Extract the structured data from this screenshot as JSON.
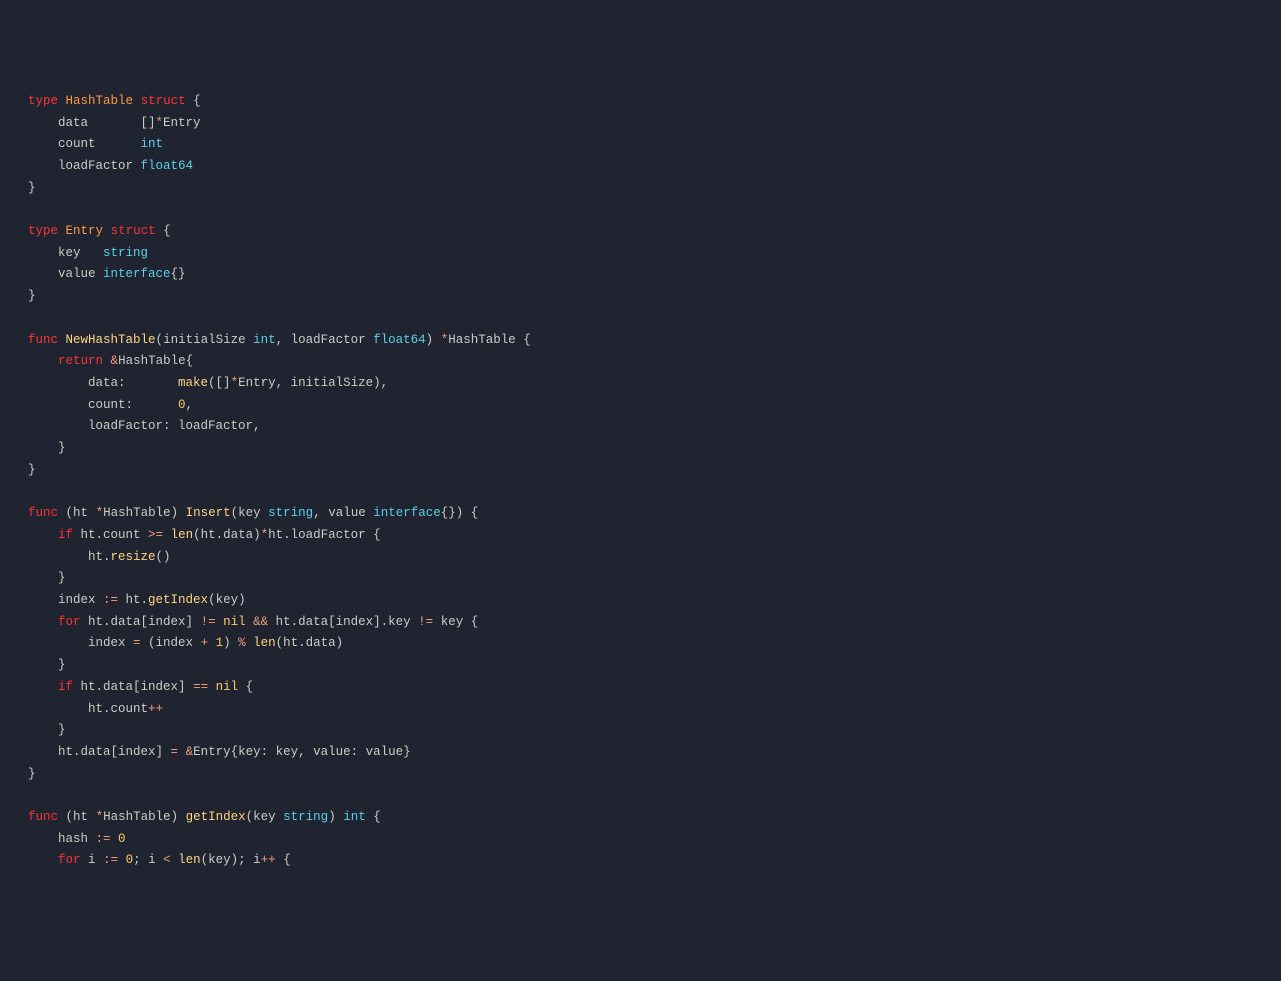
{
  "tokens": [
    [
      [
        "kw-decl",
        "type"
      ],
      [
        "",
        " "
      ],
      [
        "type-name",
        "HashTable"
      ],
      [
        "",
        " "
      ],
      [
        "kw-decl",
        "struct"
      ],
      [
        "",
        " {"
      ]
    ],
    [
      [
        "",
        "    data       []"
      ],
      [
        "op",
        "*"
      ],
      [
        "",
        "Entry"
      ]
    ],
    [
      [
        "",
        "    count      "
      ],
      [
        "builtin-type",
        "int"
      ]
    ],
    [
      [
        "",
        "    loadFactor "
      ],
      [
        "builtin-type",
        "float64"
      ]
    ],
    [
      [
        "",
        "}"
      ]
    ],
    [
      [
        "",
        ""
      ]
    ],
    [
      [
        "kw-decl",
        "type"
      ],
      [
        "",
        " "
      ],
      [
        "type-name",
        "Entry"
      ],
      [
        "",
        " "
      ],
      [
        "kw-decl",
        "struct"
      ],
      [
        "",
        " {"
      ]
    ],
    [
      [
        "",
        "    key   "
      ],
      [
        "str-type",
        "string"
      ]
    ],
    [
      [
        "",
        "    value "
      ],
      [
        "iface",
        "interface"
      ],
      [
        "",
        "{}"
      ]
    ],
    [
      [
        "",
        "}"
      ]
    ],
    [
      [
        "",
        ""
      ]
    ],
    [
      [
        "kw-decl",
        "func"
      ],
      [
        "",
        " "
      ],
      [
        "func-name",
        "NewHashTable"
      ],
      [
        "",
        "("
      ],
      [
        "param",
        "initialSize"
      ],
      [
        "",
        " "
      ],
      [
        "builtin-type",
        "int"
      ],
      [
        "",
        ", "
      ],
      [
        "param",
        "loadFactor"
      ],
      [
        "",
        " "
      ],
      [
        "builtin-type",
        "float64"
      ],
      [
        "",
        ") "
      ],
      [
        "op",
        "*"
      ],
      [
        "",
        "HashTable {"
      ]
    ],
    [
      [
        "",
        "    "
      ],
      [
        "kw-ctrl",
        "return"
      ],
      [
        "",
        " "
      ],
      [
        "op",
        "&"
      ],
      [
        "",
        "HashTable{"
      ]
    ],
    [
      [
        "",
        "        data:       "
      ],
      [
        "builtin-func",
        "make"
      ],
      [
        "",
        "([]"
      ],
      [
        "op",
        "*"
      ],
      [
        "",
        "Entry, initialSize),"
      ]
    ],
    [
      [
        "",
        "        count:      "
      ],
      [
        "num",
        "0"
      ],
      [
        "",
        ","
      ]
    ],
    [
      [
        "",
        "        loadFactor: loadFactor,"
      ]
    ],
    [
      [
        "",
        "    }"
      ]
    ],
    [
      [
        "",
        "}"
      ]
    ],
    [
      [
        "",
        ""
      ]
    ],
    [
      [
        "kw-decl",
        "func"
      ],
      [
        "",
        " ("
      ],
      [
        "param",
        "ht"
      ],
      [
        "",
        " "
      ],
      [
        "op",
        "*"
      ],
      [
        "",
        "HashTable"
      ],
      [
        "",
        ") "
      ],
      [
        "func-name",
        "Insert"
      ],
      [
        "",
        "("
      ],
      [
        "param",
        "key"
      ],
      [
        "",
        " "
      ],
      [
        "str-type",
        "string"
      ],
      [
        "",
        ", "
      ],
      [
        "param",
        "value"
      ],
      [
        "",
        " "
      ],
      [
        "iface",
        "interface"
      ],
      [
        "",
        "{}) {"
      ]
    ],
    [
      [
        "",
        "    "
      ],
      [
        "kw-ctrl",
        "if"
      ],
      [
        "",
        " ht.count "
      ],
      [
        "op",
        ">="
      ],
      [
        "",
        " "
      ],
      [
        "builtin-func",
        "len"
      ],
      [
        "",
        "(ht.data)"
      ],
      [
        "op",
        "*"
      ],
      [
        "",
        "ht.loadFactor {"
      ]
    ],
    [
      [
        "",
        "        ht."
      ],
      [
        "func-name",
        "resize"
      ],
      [
        "",
        "()"
      ]
    ],
    [
      [
        "",
        "    }"
      ]
    ],
    [
      [
        "",
        "    index "
      ],
      [
        "op",
        ":="
      ],
      [
        "",
        " ht."
      ],
      [
        "func-name",
        "getIndex"
      ],
      [
        "",
        "(key)"
      ]
    ],
    [
      [
        "",
        "    "
      ],
      [
        "kw-ctrl",
        "for"
      ],
      [
        "",
        " ht.data[index] "
      ],
      [
        "op",
        "!="
      ],
      [
        "",
        " "
      ],
      [
        "nil",
        "nil"
      ],
      [
        "",
        " "
      ],
      [
        "op",
        "&&"
      ],
      [
        "",
        " ht.data[index].key "
      ],
      [
        "op",
        "!="
      ],
      [
        "",
        " key {"
      ]
    ],
    [
      [
        "",
        "        index "
      ],
      [
        "op",
        "="
      ],
      [
        "",
        " (index "
      ],
      [
        "op",
        "+"
      ],
      [
        "",
        " "
      ],
      [
        "num",
        "1"
      ],
      [
        "",
        ") "
      ],
      [
        "op",
        "%"
      ],
      [
        "",
        " "
      ],
      [
        "builtin-func",
        "len"
      ],
      [
        "",
        "(ht.data)"
      ]
    ],
    [
      [
        "",
        "    }"
      ]
    ],
    [
      [
        "",
        "    "
      ],
      [
        "kw-ctrl",
        "if"
      ],
      [
        "",
        " ht.data[index] "
      ],
      [
        "op",
        "=="
      ],
      [
        "",
        " "
      ],
      [
        "nil",
        "nil"
      ],
      [
        "",
        " {"
      ]
    ],
    [
      [
        "",
        "        ht.count"
      ],
      [
        "op",
        "++"
      ]
    ],
    [
      [
        "",
        "    }"
      ]
    ],
    [
      [
        "",
        "    ht.data[index] "
      ],
      [
        "op",
        "="
      ],
      [
        "",
        " "
      ],
      [
        "op",
        "&"
      ],
      [
        "",
        "Entry{key: key, value: value}"
      ]
    ],
    [
      [
        "",
        "}"
      ]
    ],
    [
      [
        "",
        ""
      ]
    ],
    [
      [
        "kw-decl",
        "func"
      ],
      [
        "",
        " ("
      ],
      [
        "param",
        "ht"
      ],
      [
        "",
        " "
      ],
      [
        "op",
        "*"
      ],
      [
        "",
        "HashTable"
      ],
      [
        "",
        ") "
      ],
      [
        "func-name",
        "getIndex"
      ],
      [
        "",
        "("
      ],
      [
        "param",
        "key"
      ],
      [
        "",
        " "
      ],
      [
        "str-type",
        "string"
      ],
      [
        "",
        ") "
      ],
      [
        "builtin-type",
        "int"
      ],
      [
        "",
        " {"
      ]
    ],
    [
      [
        "",
        "    hash "
      ],
      [
        "op",
        ":="
      ],
      [
        "",
        " "
      ],
      [
        "num",
        "0"
      ]
    ],
    [
      [
        "",
        "    "
      ],
      [
        "kw-ctrl",
        "for"
      ],
      [
        "",
        " i "
      ],
      [
        "op",
        ":="
      ],
      [
        "",
        " "
      ],
      [
        "num",
        "0"
      ],
      [
        "",
        "; i "
      ],
      [
        "op",
        "<"
      ],
      [
        "",
        " "
      ],
      [
        "builtin-func",
        "len"
      ],
      [
        "",
        "(key); i"
      ],
      [
        "op",
        "++"
      ],
      [
        "",
        " {"
      ]
    ]
  ]
}
